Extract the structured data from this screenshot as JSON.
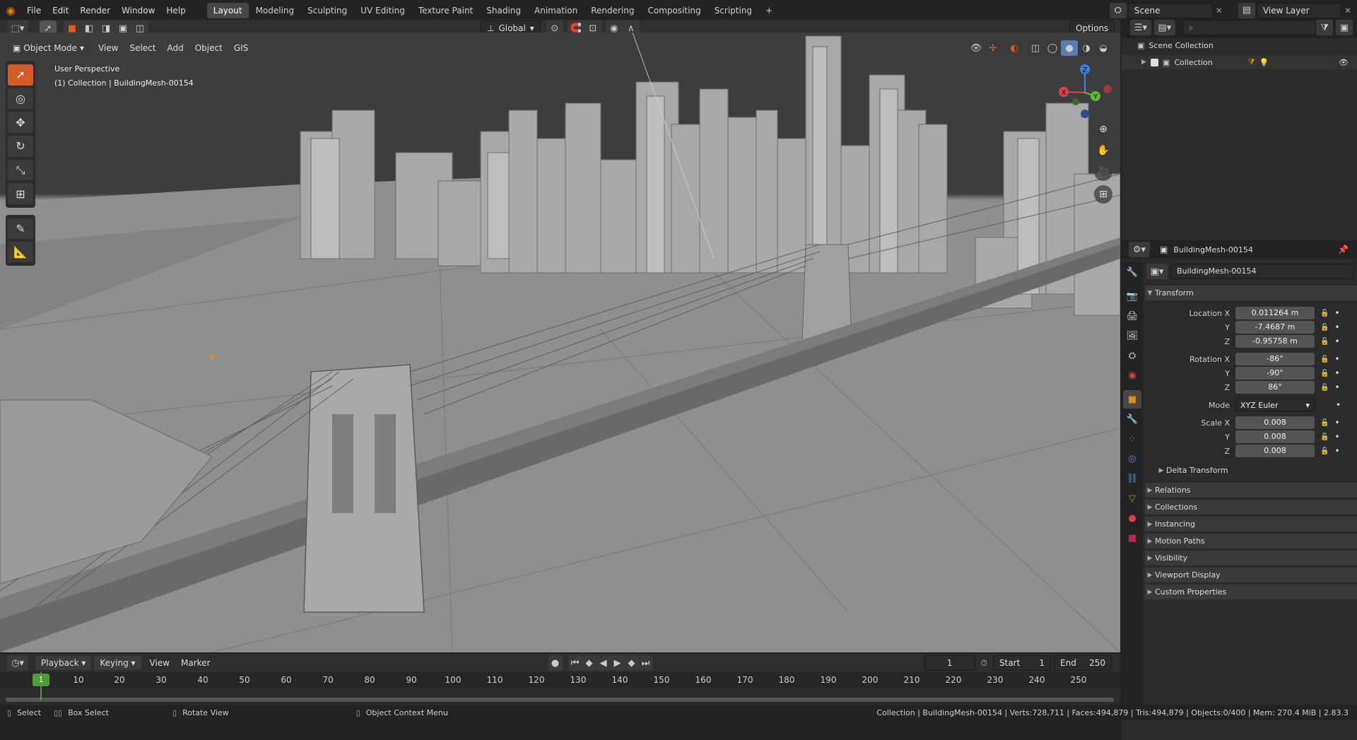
{
  "menu": [
    "File",
    "Edit",
    "Render",
    "Window",
    "Help"
  ],
  "workspaces": [
    "Layout",
    "Modeling",
    "Sculpting",
    "UV Editing",
    "Texture Paint",
    "Shading",
    "Animation",
    "Rendering",
    "Compositing",
    "Scripting"
  ],
  "scene_name": "Scene",
  "view_layer": "View Layer",
  "viewport": {
    "mode": "Object Mode",
    "menus": [
      "View",
      "Select",
      "Add",
      "Object",
      "GIS"
    ],
    "transform_orientation": "Global",
    "options_label": "Options",
    "info_line1": "User Perspective",
    "info_line2": "(1) Collection | BuildingMesh-00154",
    "gizmo": {
      "x": "X",
      "y": "Y",
      "z": "Z"
    }
  },
  "outliner": {
    "root": "Scene Collection",
    "collection": "Collection"
  },
  "properties": {
    "object_name": "BuildingMesh-00154",
    "data_name": "BuildingMesh-00154",
    "transform_header": "Transform",
    "location": {
      "label_x": "Location X",
      "label_y": "Y",
      "label_z": "Z",
      "x": "0.011264 m",
      "y": "-7.4687 m",
      "z": "-0.95758 m"
    },
    "rotation": {
      "label_x": "Rotation X",
      "label_y": "Y",
      "label_z": "Z",
      "x": "-86°",
      "y": "-90°",
      "z": "86°"
    },
    "mode": {
      "label": "Mode",
      "value": "XYZ Euler"
    },
    "scale": {
      "label_x": "Scale X",
      "label_y": "Y",
      "label_z": "Z",
      "x": "0.008",
      "y": "0.008",
      "z": "0.008"
    },
    "delta": "Delta Transform",
    "panels": [
      "Relations",
      "Collections",
      "Instancing",
      "Motion Paths",
      "Visibility",
      "Viewport Display",
      "Custom Properties"
    ]
  },
  "timeline": {
    "menus": [
      "Playback",
      "Keying",
      "View",
      "Marker"
    ],
    "current_frame": "1",
    "start_label": "Start",
    "start": "1",
    "end_label": "End",
    "end": "250",
    "playhead": "1",
    "ticks": [
      "10",
      "20",
      "30",
      "40",
      "50",
      "60",
      "70",
      "80",
      "90",
      "100",
      "110",
      "120",
      "130",
      "140",
      "150",
      "160",
      "170",
      "180",
      "190",
      "200",
      "210",
      "220",
      "230",
      "240",
      "250"
    ]
  },
  "statusbar": {
    "select": "Select",
    "box_select": "Box Select",
    "rotate_view": "Rotate View",
    "context_menu": "Object Context Menu",
    "stats": "Collection | BuildingMesh-00154 | Verts:728,711 | Faces:494,879 | Tris:494,879 | Objects:0/400 | Mem: 270.4 MiB | 2.83.3"
  },
  "colors": {
    "accent": "#d45a28",
    "active_frame": "#4f9a3a",
    "x_axis": "#e0404f",
    "y_axis": "#5fba3a",
    "z_axis": "#3f7fe0"
  }
}
